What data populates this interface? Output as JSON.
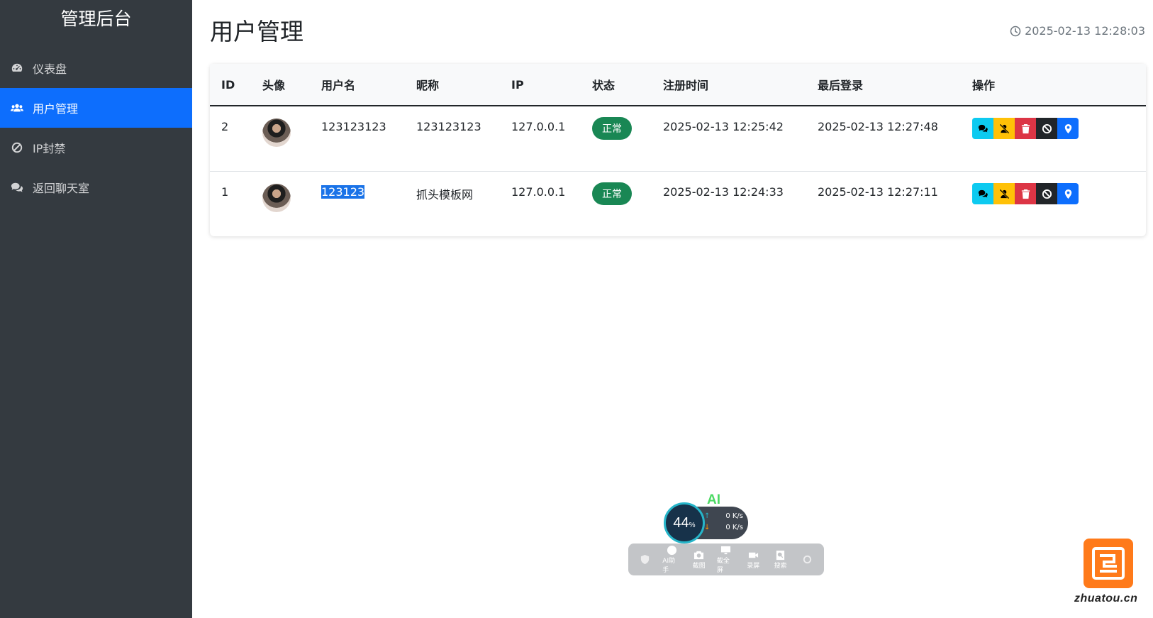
{
  "sidebar": {
    "brand": "管理后台",
    "items": [
      {
        "label": "仪表盘",
        "icon": "dashboard-icon",
        "active": false
      },
      {
        "label": "用户管理",
        "icon": "users-icon",
        "active": true
      },
      {
        "label": "IP封禁",
        "icon": "ban-icon",
        "active": false
      },
      {
        "label": "返回聊天室",
        "icon": "comments-icon",
        "active": false
      }
    ]
  },
  "header": {
    "title": "用户管理",
    "datetime": "2025-02-13 12:28:03"
  },
  "table": {
    "columns": [
      "ID",
      "头像",
      "用户名",
      "昵称",
      "IP",
      "状态",
      "注册时间",
      "最后登录",
      "操作"
    ],
    "rows": [
      {
        "id": "2",
        "username": "123123123",
        "nickname": "123123123",
        "ip": "127.0.0.1",
        "status": "正常",
        "registered": "2025-02-13 12:25:42",
        "last_login": "2025-02-13 12:27:48"
      },
      {
        "id": "1",
        "username": "123123",
        "nickname": "抓头模板网",
        "ip": "127.0.0.1",
        "status": "正常",
        "registered": "2025-02-13 12:24:33",
        "last_login": "2025-02-13 12:27:11"
      }
    ],
    "action_icons": [
      "chat-icon",
      "user-slash-icon",
      "trash-icon",
      "ban-icon",
      "location-pin-icon"
    ],
    "colors": {
      "info": "#0dcaf0",
      "warning": "#ffc107",
      "danger": "#dc3545",
      "dark": "#212529",
      "primary": "#0d6efd",
      "success": "#198754"
    }
  },
  "widget": {
    "ai_label": "AI",
    "cpu_percent": "44",
    "percent_sign": "%",
    "upload_speed": "0 K/s",
    "download_speed": "0 K/s",
    "tools": [
      "AI助手",
      "截图",
      "截全屏",
      "录屏",
      "搜索"
    ]
  },
  "watermark": {
    "text": "zhuatou.cn",
    "color": "#ff7a1a"
  }
}
